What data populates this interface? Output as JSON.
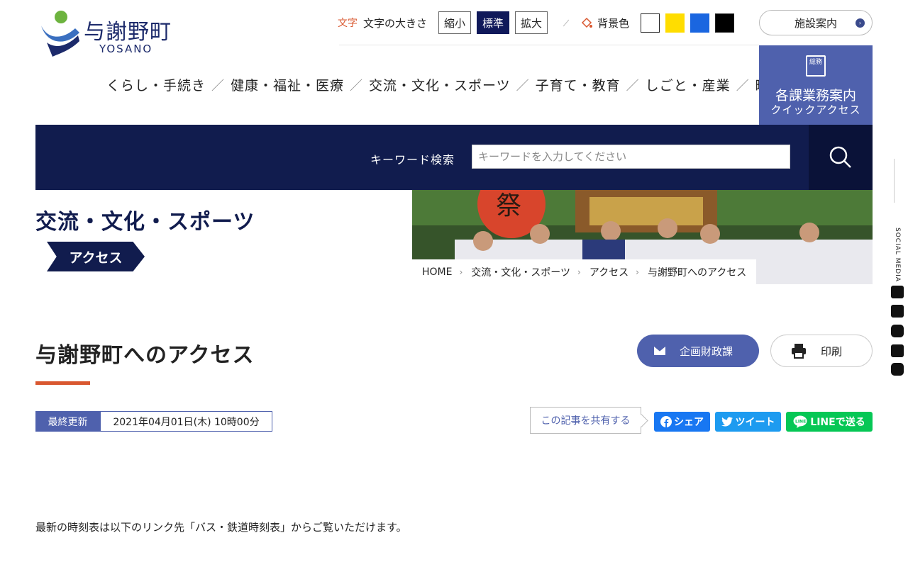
{
  "header": {
    "logo_text": "与謝野町",
    "logo_sub": "YOSANO",
    "font_size_icon": "文字",
    "font_size_label": "文字の大きさ",
    "font_sizes": [
      "縮小",
      "標準",
      "拡大"
    ],
    "bg_icon": "paint-bucket-icon",
    "bg_label": "背景色",
    "bg_colors": [
      "#ffffff",
      "#ffdd00",
      "#1a66e0",
      "#000000"
    ],
    "facility_label": "施設案内"
  },
  "nav": {
    "items": [
      "くらし・手続き",
      "健康・福祉・医療",
      "交流・文化・スポーツ",
      "子育て・教育",
      "しごと・産業",
      "町政"
    ],
    "separator": "／"
  },
  "quick_access": {
    "icon_text": "総務",
    "title": "各課業務案内",
    "subtitle": "クイックアクセス"
  },
  "search": {
    "label": "キーワード検索",
    "placeholder": "キーワードを入力してください"
  },
  "section": {
    "title": "交流・文化・スポーツ",
    "tag": "アクセス"
  },
  "breadcrumb": [
    "HOME",
    "交流・文化・スポーツ",
    "アクセス",
    "与謝野町へのアクセス"
  ],
  "page": {
    "title": "与謝野町へのアクセス",
    "dept_button": "企画財政課",
    "print_button": "印刷",
    "updated_label": "最終更新",
    "updated_value": "2021年04月01日(木) 10時00分",
    "share_label": "この記事を共有する",
    "fb_label": "シェア",
    "tw_label": "ツイート",
    "line_label": "LINEで送る",
    "body": "最新の時刻表は以下のリンク先「バス・鉄道時刻表」からご覧いただけます。"
  },
  "side": {
    "label": "SOCIAL MEDIA",
    "icons": [
      "twitter-icon",
      "facebook-icon",
      "instagram-icon",
      "youtube-icon",
      "line-icon"
    ]
  },
  "colors": {
    "navy": "#111c4e",
    "accent_blue": "#4f61ad",
    "accent_orange": "#d9572f"
  }
}
